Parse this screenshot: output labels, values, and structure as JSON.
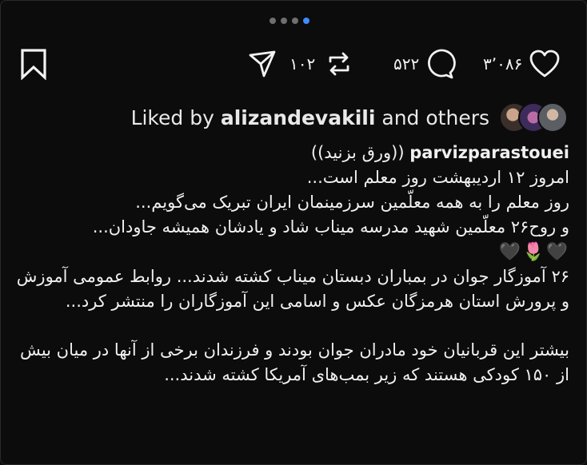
{
  "carousel": {
    "count": 4,
    "active_index": 3
  },
  "actions": {
    "likes": "۳٬۰۸۶",
    "comments": "۵۲۲",
    "reposts": "۱۰۲"
  },
  "liked_by": {
    "prefix": "Liked by",
    "user": "alizandevakili",
    "suffix": "and others"
  },
  "post": {
    "username": "parvizparastouei",
    "title": "((ورق بزنید))",
    "lines": [
      "امروز ۱۲ اردیبهشت روز معلم است...",
      "روز معلم را به همه معلّمین سرزمینمان ایران تبریک می‌گویم...",
      "و روح۲۶ معلّمین شهید مدرسه میناب شاد و یادشان همیشه جاودان..."
    ],
    "emoji": "🖤🌷🖤",
    "paragraph2": "۲۶ آموزگار جوان در بمباران دبستان میناب کشته شدند... روابط عمومی آموزش و پرورش استان هرمزگان عکس و اسامی این آموزگاران را منتشر کرد...",
    "paragraph3": "بیشتر این قربانیان خود مادران جوان بودند و فرزندان برخی از آنها در میان بیش از ۱۵۰ کودکی هستند که زیر بمب‌های آمریکا کشته شدند..."
  },
  "icons": [
    "bookmark-icon",
    "send-icon",
    "repost-icon",
    "comment-icon",
    "heart-icon"
  ]
}
